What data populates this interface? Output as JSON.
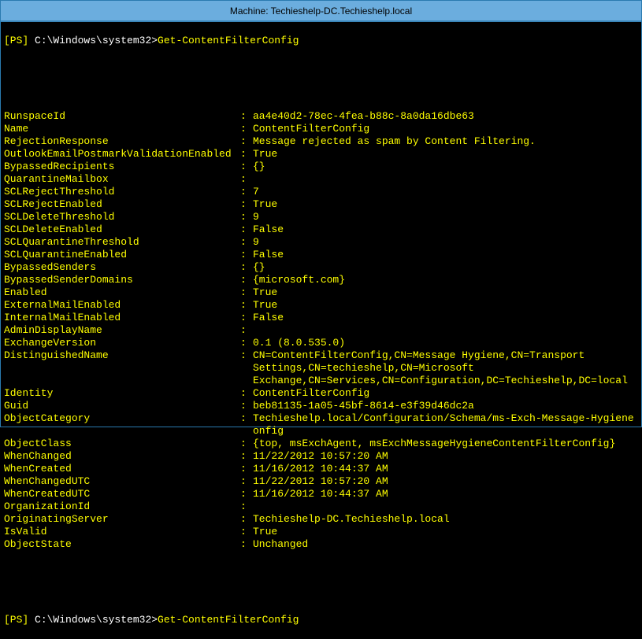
{
  "title": "Machine: Techieshelp-DC.Techieshelp.local",
  "prompt_prefix": "[PS]",
  "prompt_path": " C:\\Windows\\system32>",
  "prompt_command": "Get-ContentFilterConfig",
  "rows": [
    {
      "k": "RunspaceId",
      "v": "aa4e40d2-78ec-4fea-b88c-8a0da16dbe63"
    },
    {
      "k": "Name",
      "v": "ContentFilterConfig"
    },
    {
      "k": "RejectionResponse",
      "v": "Message rejected as spam by Content Filtering."
    },
    {
      "k": "OutlookEmailPostmarkValidationEnabled",
      "v": "True"
    },
    {
      "k": "BypassedRecipients",
      "v": "{}"
    },
    {
      "k": "QuarantineMailbox",
      "v": ""
    },
    {
      "k": "SCLRejectThreshold",
      "v": "7"
    },
    {
      "k": "SCLRejectEnabled",
      "v": "True"
    },
    {
      "k": "SCLDeleteThreshold",
      "v": "9"
    },
    {
      "k": "SCLDeleteEnabled",
      "v": "False"
    },
    {
      "k": "SCLQuarantineThreshold",
      "v": "9"
    },
    {
      "k": "SCLQuarantineEnabled",
      "v": "False"
    },
    {
      "k": "BypassedSenders",
      "v": "{}"
    },
    {
      "k": "BypassedSenderDomains",
      "v": "{microsoft.com}"
    },
    {
      "k": "Enabled",
      "v": "True"
    },
    {
      "k": "ExternalMailEnabled",
      "v": "True"
    },
    {
      "k": "InternalMailEnabled",
      "v": "False"
    },
    {
      "k": "AdminDisplayName",
      "v": ""
    },
    {
      "k": "ExchangeVersion",
      "v": "0.1 (8.0.535.0)"
    },
    {
      "k": "DistinguishedName",
      "v": "CN=ContentFilterConfig,CN=Message Hygiene,CN=Transport",
      "cont": [
        "Settings,CN=techieshelp,CN=Microsoft",
        "Exchange,CN=Services,CN=Configuration,DC=Techieshelp,DC=local"
      ]
    },
    {
      "k": "Identity",
      "v": "ContentFilterConfig"
    },
    {
      "k": "Guid",
      "v": "beb81135-1a05-45bf-8614-e3f39d46dc2a"
    },
    {
      "k": "ObjectCategory",
      "v": "Techieshelp.local/Configuration/Schema/ms-Exch-Message-Hygiene",
      "cont": [
        "onfig"
      ]
    },
    {
      "k": "ObjectClass",
      "v": "{top, msExchAgent, msExchMessageHygieneContentFilterConfig}"
    },
    {
      "k": "WhenChanged",
      "v": "11/22/2012 10:57:20 AM"
    },
    {
      "k": "WhenCreated",
      "v": "11/16/2012 10:44:37 AM"
    },
    {
      "k": "WhenChangedUTC",
      "v": "11/22/2012 10:57:20 AM"
    },
    {
      "k": "WhenCreatedUTC",
      "v": "11/16/2012 10:44:37 AM"
    },
    {
      "k": "OrganizationId",
      "v": ""
    },
    {
      "k": "OriginatingServer",
      "v": "Techieshelp-DC.Techieshelp.local"
    },
    {
      "k": "IsValid",
      "v": "True"
    },
    {
      "k": "ObjectState",
      "v": "Unchanged"
    }
  ]
}
